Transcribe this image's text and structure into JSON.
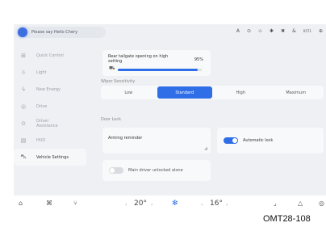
{
  "assistant": {
    "prompt": "Please say Hello Chery"
  },
  "status": {
    "icons": [
      "A",
      "⊙",
      "⊹",
      "✱",
      "✖",
      "&",
      "0571",
      "⊕"
    ]
  },
  "sidebar": {
    "items": [
      {
        "label": "Quick Control",
        "icon": "grid-icon"
      },
      {
        "label": "Light",
        "icon": "light-icon"
      },
      {
        "label": "New Energy",
        "icon": "energy-icon"
      },
      {
        "label": "Drive",
        "icon": "drive-icon"
      },
      {
        "label": "Driver Assistance",
        "icon": "steering-icon"
      },
      {
        "label": "HUD",
        "icon": "hud-icon"
      },
      {
        "label": "Vehicle Settings",
        "icon": "car-icon"
      }
    ]
  },
  "tailgate": {
    "label": "Rear tailgate opening on high setting",
    "percent": "95%",
    "level": 0.95
  },
  "wiper": {
    "title": "Wiper Sensitivity",
    "options": [
      "Low",
      "Standard",
      "High",
      "Maximum"
    ],
    "selected": "Standard"
  },
  "door_lock": {
    "title": "Door Lock",
    "arming": "Arming reminder",
    "autolock": {
      "label": "Automatic lock",
      "on": true
    },
    "main_unlock": {
      "label": "Main driver unlocked alone",
      "on": false
    }
  },
  "bottom": {
    "left_temp": "20°",
    "right_temp": "16°",
    "arrow_left": "‹",
    "arrow_right": "›"
  },
  "figure_code": "OMT28-108",
  "colors": {
    "accent": "#2f6ee6",
    "screen_bg": "#eef0f3"
  }
}
